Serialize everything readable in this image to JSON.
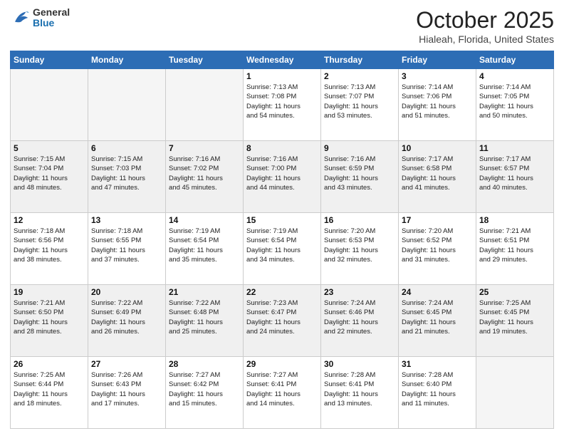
{
  "header": {
    "logo_general": "General",
    "logo_blue": "Blue",
    "month_title": "October 2025",
    "location": "Hialeah, Florida, United States"
  },
  "weekdays": [
    "Sunday",
    "Monday",
    "Tuesday",
    "Wednesday",
    "Thursday",
    "Friday",
    "Saturday"
  ],
  "weeks": [
    [
      {
        "day": "",
        "info": ""
      },
      {
        "day": "",
        "info": ""
      },
      {
        "day": "",
        "info": ""
      },
      {
        "day": "1",
        "info": "Sunrise: 7:13 AM\nSunset: 7:08 PM\nDaylight: 11 hours\nand 54 minutes."
      },
      {
        "day": "2",
        "info": "Sunrise: 7:13 AM\nSunset: 7:07 PM\nDaylight: 11 hours\nand 53 minutes."
      },
      {
        "day": "3",
        "info": "Sunrise: 7:14 AM\nSunset: 7:06 PM\nDaylight: 11 hours\nand 51 minutes."
      },
      {
        "day": "4",
        "info": "Sunrise: 7:14 AM\nSunset: 7:05 PM\nDaylight: 11 hours\nand 50 minutes."
      }
    ],
    [
      {
        "day": "5",
        "info": "Sunrise: 7:15 AM\nSunset: 7:04 PM\nDaylight: 11 hours\nand 48 minutes."
      },
      {
        "day": "6",
        "info": "Sunrise: 7:15 AM\nSunset: 7:03 PM\nDaylight: 11 hours\nand 47 minutes."
      },
      {
        "day": "7",
        "info": "Sunrise: 7:16 AM\nSunset: 7:02 PM\nDaylight: 11 hours\nand 45 minutes."
      },
      {
        "day": "8",
        "info": "Sunrise: 7:16 AM\nSunset: 7:00 PM\nDaylight: 11 hours\nand 44 minutes."
      },
      {
        "day": "9",
        "info": "Sunrise: 7:16 AM\nSunset: 6:59 PM\nDaylight: 11 hours\nand 43 minutes."
      },
      {
        "day": "10",
        "info": "Sunrise: 7:17 AM\nSunset: 6:58 PM\nDaylight: 11 hours\nand 41 minutes."
      },
      {
        "day": "11",
        "info": "Sunrise: 7:17 AM\nSunset: 6:57 PM\nDaylight: 11 hours\nand 40 minutes."
      }
    ],
    [
      {
        "day": "12",
        "info": "Sunrise: 7:18 AM\nSunset: 6:56 PM\nDaylight: 11 hours\nand 38 minutes."
      },
      {
        "day": "13",
        "info": "Sunrise: 7:18 AM\nSunset: 6:55 PM\nDaylight: 11 hours\nand 37 minutes."
      },
      {
        "day": "14",
        "info": "Sunrise: 7:19 AM\nSunset: 6:54 PM\nDaylight: 11 hours\nand 35 minutes."
      },
      {
        "day": "15",
        "info": "Sunrise: 7:19 AM\nSunset: 6:54 PM\nDaylight: 11 hours\nand 34 minutes."
      },
      {
        "day": "16",
        "info": "Sunrise: 7:20 AM\nSunset: 6:53 PM\nDaylight: 11 hours\nand 32 minutes."
      },
      {
        "day": "17",
        "info": "Sunrise: 7:20 AM\nSunset: 6:52 PM\nDaylight: 11 hours\nand 31 minutes."
      },
      {
        "day": "18",
        "info": "Sunrise: 7:21 AM\nSunset: 6:51 PM\nDaylight: 11 hours\nand 29 minutes."
      }
    ],
    [
      {
        "day": "19",
        "info": "Sunrise: 7:21 AM\nSunset: 6:50 PM\nDaylight: 11 hours\nand 28 minutes."
      },
      {
        "day": "20",
        "info": "Sunrise: 7:22 AM\nSunset: 6:49 PM\nDaylight: 11 hours\nand 26 minutes."
      },
      {
        "day": "21",
        "info": "Sunrise: 7:22 AM\nSunset: 6:48 PM\nDaylight: 11 hours\nand 25 minutes."
      },
      {
        "day": "22",
        "info": "Sunrise: 7:23 AM\nSunset: 6:47 PM\nDaylight: 11 hours\nand 24 minutes."
      },
      {
        "day": "23",
        "info": "Sunrise: 7:24 AM\nSunset: 6:46 PM\nDaylight: 11 hours\nand 22 minutes."
      },
      {
        "day": "24",
        "info": "Sunrise: 7:24 AM\nSunset: 6:45 PM\nDaylight: 11 hours\nand 21 minutes."
      },
      {
        "day": "25",
        "info": "Sunrise: 7:25 AM\nSunset: 6:45 PM\nDaylight: 11 hours\nand 19 minutes."
      }
    ],
    [
      {
        "day": "26",
        "info": "Sunrise: 7:25 AM\nSunset: 6:44 PM\nDaylight: 11 hours\nand 18 minutes."
      },
      {
        "day": "27",
        "info": "Sunrise: 7:26 AM\nSunset: 6:43 PM\nDaylight: 11 hours\nand 17 minutes."
      },
      {
        "day": "28",
        "info": "Sunrise: 7:27 AM\nSunset: 6:42 PM\nDaylight: 11 hours\nand 15 minutes."
      },
      {
        "day": "29",
        "info": "Sunrise: 7:27 AM\nSunset: 6:41 PM\nDaylight: 11 hours\nand 14 minutes."
      },
      {
        "day": "30",
        "info": "Sunrise: 7:28 AM\nSunset: 6:41 PM\nDaylight: 11 hours\nand 13 minutes."
      },
      {
        "day": "31",
        "info": "Sunrise: 7:28 AM\nSunset: 6:40 PM\nDaylight: 11 hours\nand 11 minutes."
      },
      {
        "day": "",
        "info": ""
      }
    ]
  ]
}
